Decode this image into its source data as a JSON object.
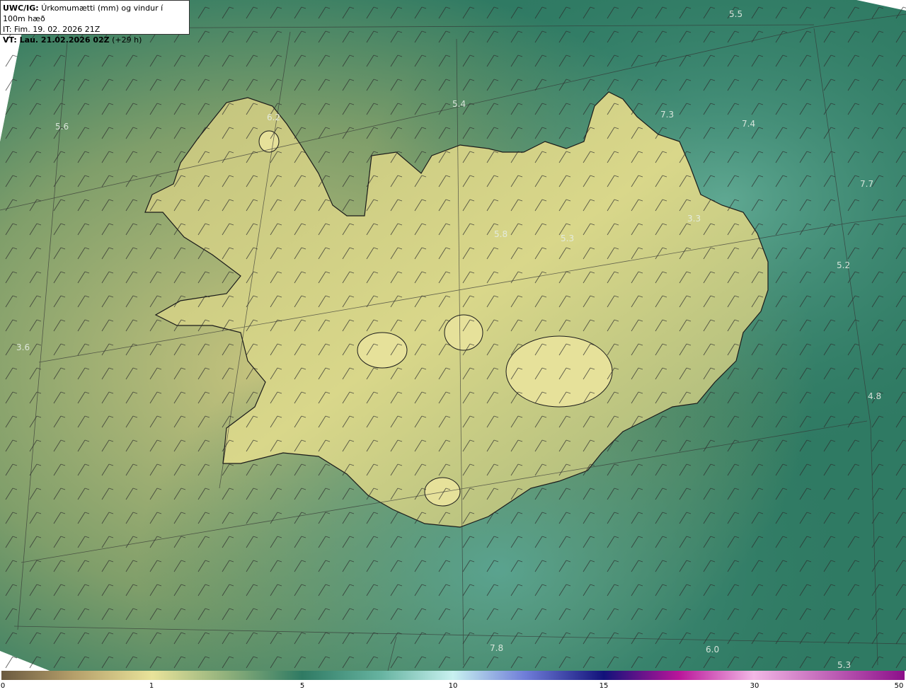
{
  "header": {
    "product": "UWC/IG:",
    "title": "Úrkomumætti (mm) og vindur í 100m hæð",
    "issue_time": "IT: Fim. 19. 02. 2026 21Z",
    "valid_prefix": "VT: Lau. 21.02.2026 02Z",
    "valid_suffix": "(+29 h)"
  },
  "map_labels": [
    {
      "text": "5.5",
      "id": "value-label-5-5"
    },
    {
      "text": "5.4",
      "id": "value-label-5-4"
    },
    {
      "text": "6.2",
      "id": "value-label-6-2"
    },
    {
      "text": "5.6",
      "id": "value-label-5-6"
    },
    {
      "text": "7.3",
      "id": "value-label-7-3"
    },
    {
      "text": "7.4",
      "id": "value-label-7-4"
    },
    {
      "text": "7.7",
      "id": "value-label-7-7"
    },
    {
      "text": "3.3",
      "id": "value-label-3-3"
    },
    {
      "text": "5.8",
      "id": "value-label-5-8"
    },
    {
      "text": "5.3",
      "id": "value-label-5-3a"
    },
    {
      "text": "5.2",
      "id": "value-label-5-2"
    },
    {
      "text": "3.6",
      "id": "value-label-3-6"
    },
    {
      "text": "4.8",
      "id": "value-label-4-8"
    },
    {
      "text": "7.8",
      "id": "value-label-7-8"
    },
    {
      "text": "6.0",
      "id": "value-label-6-0"
    },
    {
      "text": "5.3",
      "id": "value-label-5-3b"
    }
  ],
  "legend": {
    "ticks": [
      "0",
      "1",
      "5",
      "10",
      "15",
      "30",
      "50"
    ]
  },
  "colors": {
    "sea": "#2f7a63",
    "land_low": "#b9c27a",
    "land_high": "#e3e08f",
    "coastline": "#1a1a1a"
  }
}
